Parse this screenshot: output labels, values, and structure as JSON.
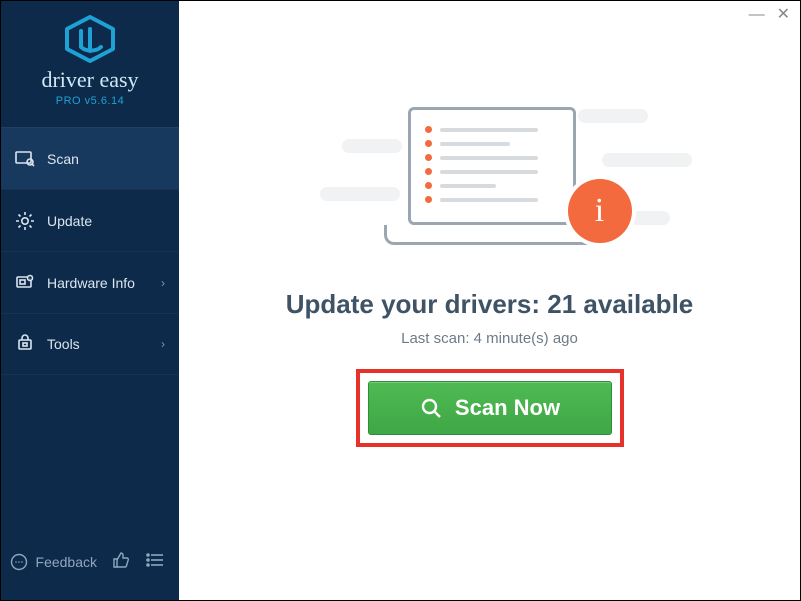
{
  "brand": {
    "title": "driver easy",
    "subtitle": "PRO v5.6.14"
  },
  "sidebar": {
    "items": [
      {
        "label": "Scan"
      },
      {
        "label": "Update"
      },
      {
        "label": "Hardware Info"
      },
      {
        "label": "Tools"
      }
    ],
    "feedback": "Feedback"
  },
  "main": {
    "headline_prefix": "Update your drivers: ",
    "available_count": 21,
    "headline_suffix": " available",
    "last_scan": "Last scan: 4 minute(s) ago",
    "scan_button": "Scan Now"
  },
  "colors": {
    "accent": "#f26a3e",
    "green": "#45b04a",
    "highlight_border": "#e6332a"
  }
}
